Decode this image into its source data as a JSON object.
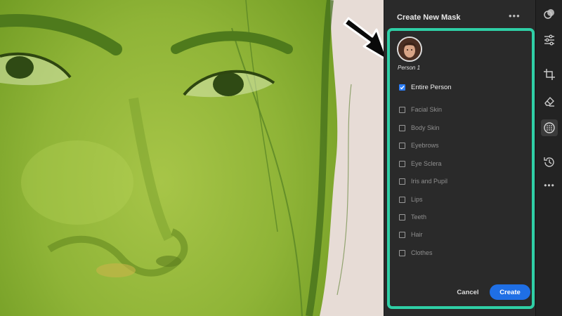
{
  "panel": {
    "title": "Create New Mask",
    "more_menu": "•••",
    "person": {
      "label": "Person 1"
    },
    "options": [
      {
        "label": "Entire Person",
        "checked": true
      },
      {
        "label": "Facial Skin",
        "checked": false
      },
      {
        "label": "Body Skin",
        "checked": false
      },
      {
        "label": "Eyebrows",
        "checked": false
      },
      {
        "label": "Eye Sclera",
        "checked": false
      },
      {
        "label": "Iris and Pupil",
        "checked": false
      },
      {
        "label": "Lips",
        "checked": false
      },
      {
        "label": "Teeth",
        "checked": false
      },
      {
        "label": "Hair",
        "checked": false
      },
      {
        "label": "Clothes",
        "checked": false
      }
    ],
    "cancel_label": "Cancel",
    "create_label": "Create",
    "highlight_color": "#2fcfa6",
    "accent_color": "#1f6fe5"
  },
  "toolbar": {
    "items": [
      {
        "icon": "adjust-overlap-icon"
      },
      {
        "icon": "sliders-icon"
      },
      {
        "icon": "crop-icon"
      },
      {
        "icon": "eraser-icon"
      },
      {
        "icon": "masking-icon",
        "active": true
      },
      {
        "icon": "history-icon"
      },
      {
        "icon": "more-icon",
        "label": "•••"
      }
    ]
  },
  "canvas": {
    "overlay_color": "#8fb437"
  }
}
